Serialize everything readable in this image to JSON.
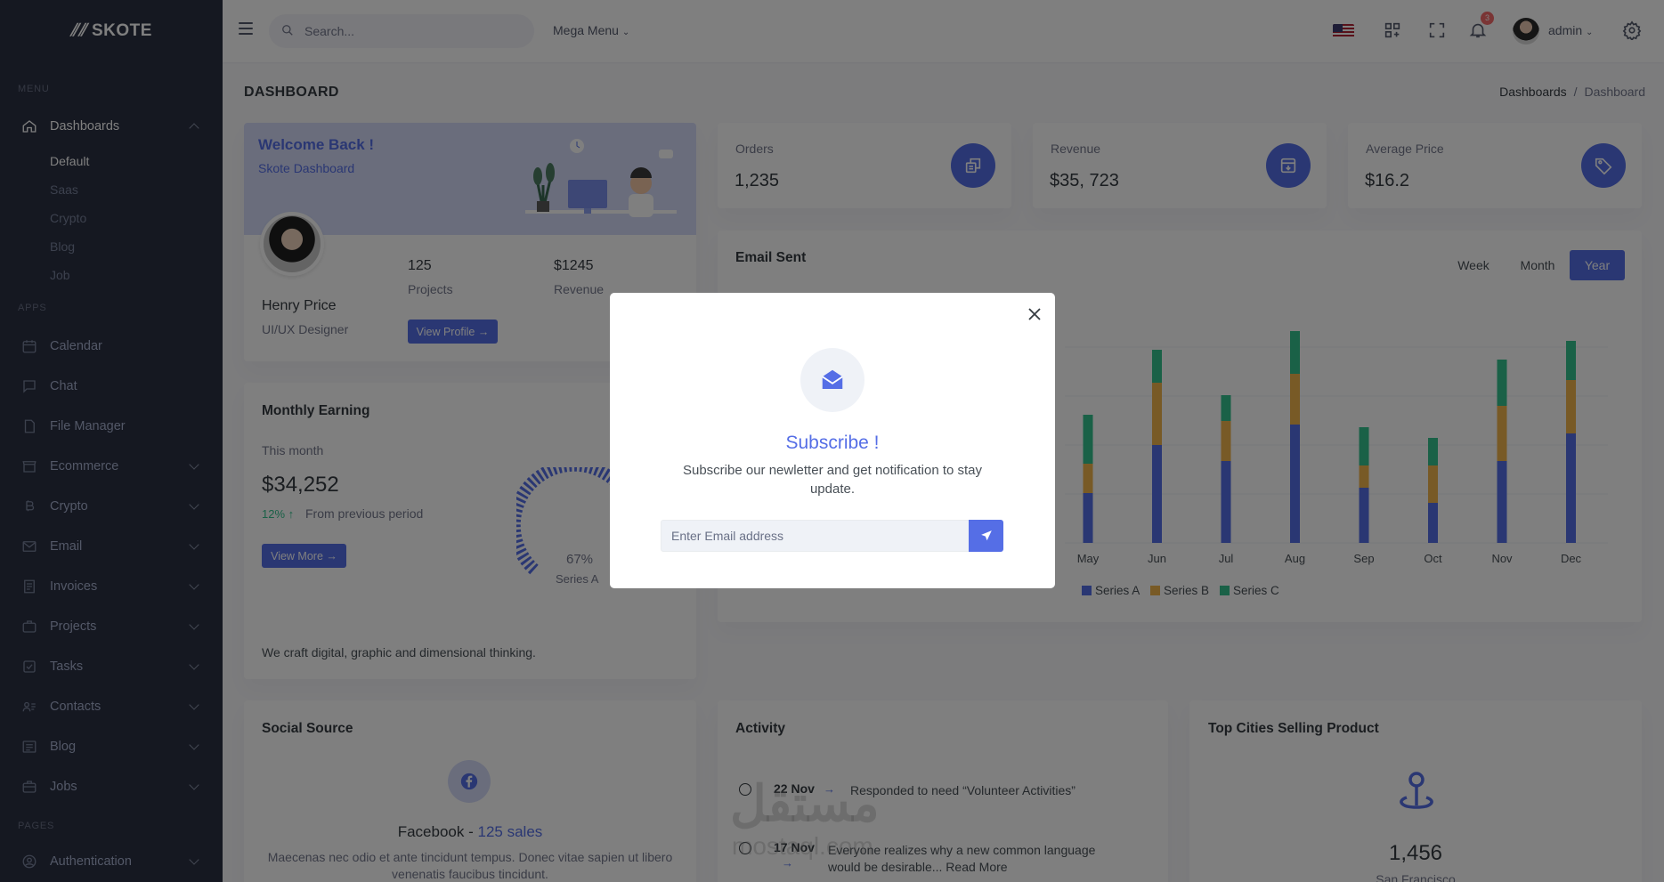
{
  "app": {
    "logo": "SKOTE"
  },
  "sidebar": {
    "menu_title": "MENU",
    "apps_title": "APPS",
    "pages_title": "PAGES",
    "dashboards": {
      "label": "Dashboards",
      "children": [
        "Default",
        "Saas",
        "Crypto",
        "Blog",
        "Job"
      ]
    },
    "items": [
      "Calendar",
      "Chat",
      "File Manager",
      "Ecommerce",
      "Crypto",
      "Email",
      "Invoices",
      "Projects",
      "Tasks",
      "Contacts",
      "Blog",
      "Jobs"
    ],
    "auth": "Authentication"
  },
  "topbar": {
    "search_placeholder": "Search...",
    "mega_menu": "Mega Menu",
    "notif_count": "3",
    "user": "admin"
  },
  "page": {
    "title": "DASHBOARD",
    "breadcrumb": [
      "Dashboards",
      "Dashboard"
    ]
  },
  "welcome": {
    "title": "Welcome Back !",
    "subtitle": "Skote Dashboard",
    "name": "Henry Price",
    "role": "UI/UX Designer",
    "projects_val": "125",
    "projects_label": "Projects",
    "revenue_val": "$1245",
    "revenue_label": "Revenue",
    "button": "View Profile"
  },
  "stats": [
    {
      "label": "Orders",
      "value": "1,235"
    },
    {
      "label": "Revenue",
      "value": "$35, 723"
    },
    {
      "label": "Average Price",
      "value": "$16.2"
    }
  ],
  "email_sent": {
    "title": "Email Sent",
    "tabs": [
      "Week",
      "Month",
      "Year"
    ],
    "active_tab": "Year"
  },
  "chart_data": {
    "type": "bar",
    "stacked": true,
    "categories": [
      "May",
      "Jun",
      "Jul",
      "Aug",
      "Sep",
      "Oct",
      "Nov",
      "Dec"
    ],
    "series": [
      {
        "name": "Series A",
        "color": "#556ee6",
        "values": [
          56,
          110,
          92,
          133,
          62,
          45,
          92,
          123
        ]
      },
      {
        "name": "Series B",
        "color": "#f1b44c",
        "values": [
          33,
          70,
          45,
          57,
          25,
          42,
          62,
          60
        ]
      },
      {
        "name": "Series C",
        "color": "#34c38f",
        "values": [
          55,
          37,
          29,
          48,
          43,
          31,
          52,
          44
        ]
      }
    ],
    "legend": "bottom"
  },
  "monthly": {
    "title": "Monthly Earning",
    "period": "This month",
    "value": "$34,252",
    "pct": "12%",
    "pct_text": "From previous period",
    "button": "View More",
    "gauge_pct": "67%",
    "gauge_label": "Series A",
    "footer": "We craft digital, graphic and dimensional thinking."
  },
  "social": {
    "title": "Social Source",
    "name": "Facebook",
    "sales": "125 sales",
    "text": "Maecenas nec odio et ante tincidunt tempus. Donec vitae sapien ut libero venenatis faucibus tincidunt."
  },
  "activity": {
    "title": "Activity",
    "items": [
      {
        "date": "22 Nov",
        "text": "Responded to need “Volunteer Activities”"
      },
      {
        "date": "17 Nov",
        "text": "Everyone realizes why a new common language would be desirable... Read More"
      }
    ]
  },
  "cities": {
    "title": "Top Cities Selling Product",
    "value": "1,456",
    "city": "San Francisco"
  },
  "modal": {
    "title": "Subscribe !",
    "text": "Subscribe our newletter and get notification to stay update.",
    "placeholder": "Enter Email address"
  },
  "watermark": {
    "arabic": "مستقل",
    "latin": "mostaql.com"
  }
}
